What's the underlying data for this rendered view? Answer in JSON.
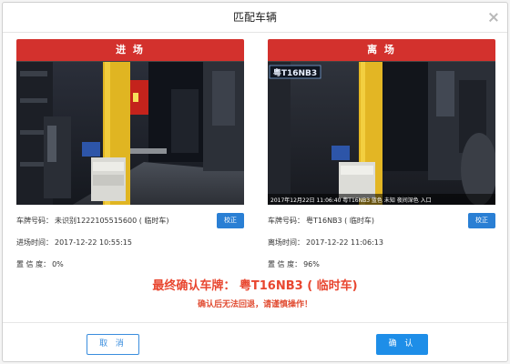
{
  "dialog": {
    "title": "匹配车辆"
  },
  "entry": {
    "header": "进 场",
    "plate_label": "车牌号码：",
    "plate_value": "未识别1222105515600 ( 临时车)",
    "time_label": "进场时间：",
    "time_value": "2017-12-22 10:55:15",
    "confidence_label": "置 信 度：",
    "confidence_value": "0%",
    "correct_label": "校正"
  },
  "exit": {
    "header": "离 场",
    "plate_label": "车牌号码：",
    "plate_value": "粤T16NB3 ( 临时车)",
    "time_label": "离场时间：",
    "time_value": "2017-12-22 11:06:13",
    "confidence_label": "置 信 度：",
    "confidence_value": "96%",
    "correct_label": "校正",
    "overlay_plate": "粤T16NB3",
    "overlay_caption": "2017年12月22日 11:06:40 粤T16NB3 蓝色 未知 夜间深色 入口"
  },
  "final": {
    "plate_text": "最终确认车牌： 粤T16NB3 ( 临时车)",
    "warning": "确认后无法回退，请谨慎操作！"
  },
  "buttons": {
    "cancel": "取 消",
    "confirm": "确 认"
  },
  "colors": {
    "header_red": "#d3312d",
    "primary_blue": "#1e8ee8",
    "alert_red": "#e8462f"
  }
}
